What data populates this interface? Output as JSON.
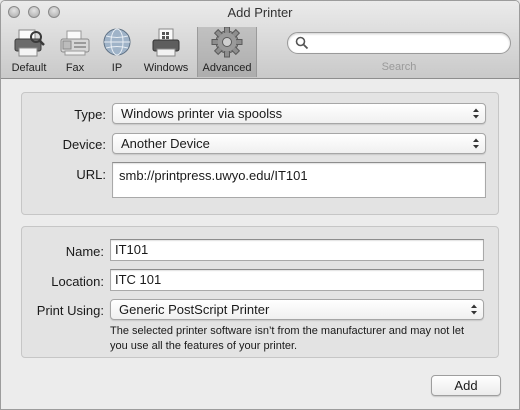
{
  "window": {
    "title": "Add Printer"
  },
  "toolbar": {
    "items": [
      {
        "label": "Default",
        "icon": "default-printer-icon"
      },
      {
        "label": "Fax",
        "icon": "fax-icon"
      },
      {
        "label": "IP",
        "icon": "globe-icon"
      },
      {
        "label": "Windows",
        "icon": "windows-printer-icon"
      },
      {
        "label": "Advanced",
        "icon": "gear-icon",
        "selected": true
      }
    ],
    "search": {
      "placeholder": "",
      "label": "Search"
    }
  },
  "connection": {
    "type_label": "Type:",
    "type_value": "Windows printer via spoolss",
    "device_label": "Device:",
    "device_value": "Another Device",
    "url_label": "URL:",
    "url_value": "smb://printpress.uwyo.edu/IT101"
  },
  "details": {
    "name_label": "Name:",
    "name_value": "IT101",
    "location_label": "Location:",
    "location_value": "ITC 101",
    "print_using_label": "Print Using:",
    "print_using_value": "Generic PostScript Printer",
    "note": "The selected printer software isn’t from the manufacturer and may not let you use all the features of your printer."
  },
  "actions": {
    "add_label": "Add"
  }
}
